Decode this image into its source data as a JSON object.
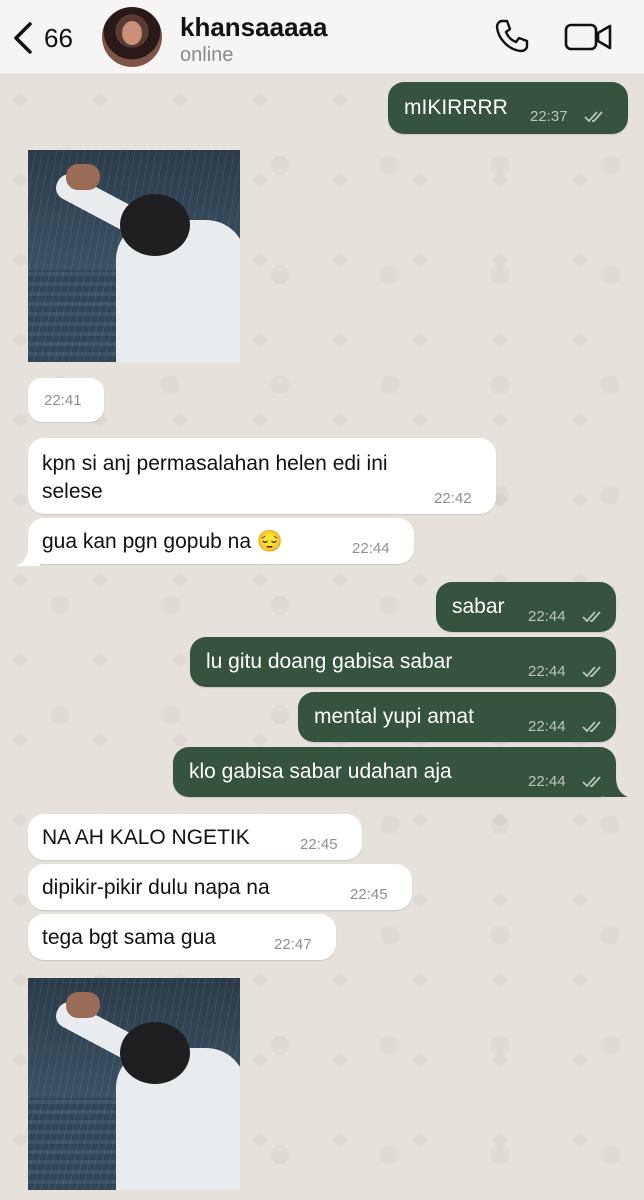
{
  "header": {
    "back_count": "66",
    "contact_name": "khansaaaaa",
    "status": "online"
  },
  "messages": [
    {
      "dir": "out",
      "text": "mIKIRRRR",
      "time": "22:37"
    },
    {
      "dir": "in",
      "type": "image",
      "time": "22:41"
    },
    {
      "dir": "in",
      "text_line1": "kpn si anj permasalahan helen edi ini",
      "text_line2": "selese",
      "time": "22:42"
    },
    {
      "dir": "in",
      "text": "gua kan pgn gopub na 😔",
      "time": "22:44"
    },
    {
      "dir": "out",
      "text": "sabar",
      "time": "22:44"
    },
    {
      "dir": "out",
      "text": "lu gitu doang gabisa sabar",
      "time": "22:44"
    },
    {
      "dir": "out",
      "text": "mental yupi amat",
      "time": "22:44"
    },
    {
      "dir": "out",
      "text": "klo gabisa sabar udahan aja",
      "time": "22:44"
    },
    {
      "dir": "in",
      "text": "NA AH KALO NGETIK",
      "time": "22:45"
    },
    {
      "dir": "in",
      "text": "dipikir-pikir dulu napa na",
      "time": "22:45"
    },
    {
      "dir": "in",
      "text": "tega bgt sama gua",
      "time": "22:47"
    },
    {
      "dir": "in",
      "type": "image"
    }
  ],
  "colors": {
    "outgoing_bubble": "#36533d",
    "incoming_bubble": "#ffffff",
    "background": "#e6e1db"
  },
  "icons": [
    "chevron-left-icon",
    "phone-icon",
    "video-camera-icon",
    "double-check-icon"
  ]
}
